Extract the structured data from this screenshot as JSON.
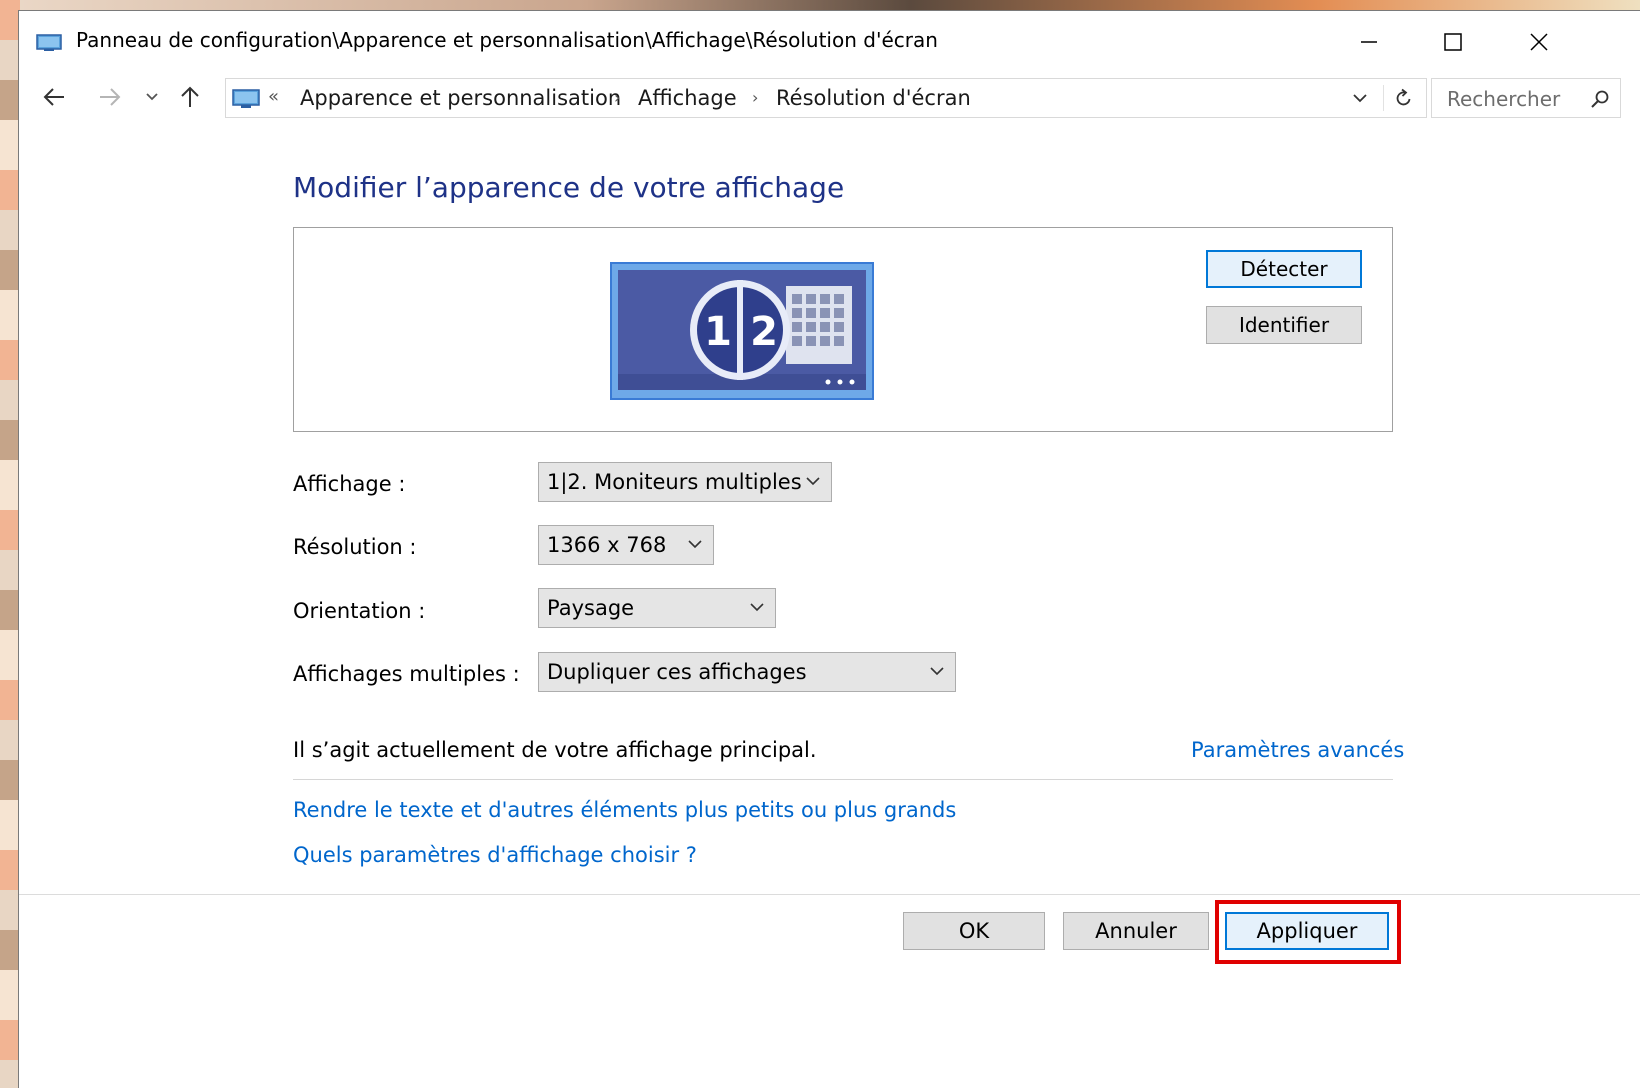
{
  "window": {
    "title": "Panneau de configuration\\Apparence et personnalisation\\Affichage\\Résolution d'écran"
  },
  "address_bar": {
    "overflow_chevrons": "«",
    "breadcrumbs": [
      {
        "label": "Apparence et personnalisation"
      },
      {
        "label": "Affichage"
      },
      {
        "label": "Résolution d'écran"
      }
    ],
    "separator": "›",
    "search_placeholder": "Rechercher"
  },
  "main": {
    "heading": "Modifier l’apparence de votre affichage",
    "monitor_graphic": {
      "label_1": "1",
      "label_2": "2"
    },
    "detect_label": "Détecter",
    "identify_label": "Identifier",
    "fields": {
      "display": {
        "label": "Affichage :",
        "value": "1|2. Moniteurs multiples"
      },
      "resolution": {
        "label": "Résolution :",
        "value": "1366 x 768"
      },
      "orientation": {
        "label": "Orientation :",
        "value": "Paysage"
      },
      "multiple": {
        "label": "Affichages multiples :",
        "value": "Dupliquer ces affichages"
      }
    },
    "status": "Il s’agit actuellement de votre affichage principal.",
    "advanced_link": "Paramètres avancés",
    "links": [
      "Rendre le texte et d'autres éléments plus petits ou plus grands",
      "Quels paramètres d'affichage choisir ?"
    ]
  },
  "footer": {
    "ok_label": "OK",
    "cancel_label": "Annuler",
    "apply_label": "Appliquer"
  },
  "colors": {
    "heading": "#1e3287",
    "link": "#0066cc",
    "highlight": "#e00000",
    "focus": "#0078d7"
  }
}
